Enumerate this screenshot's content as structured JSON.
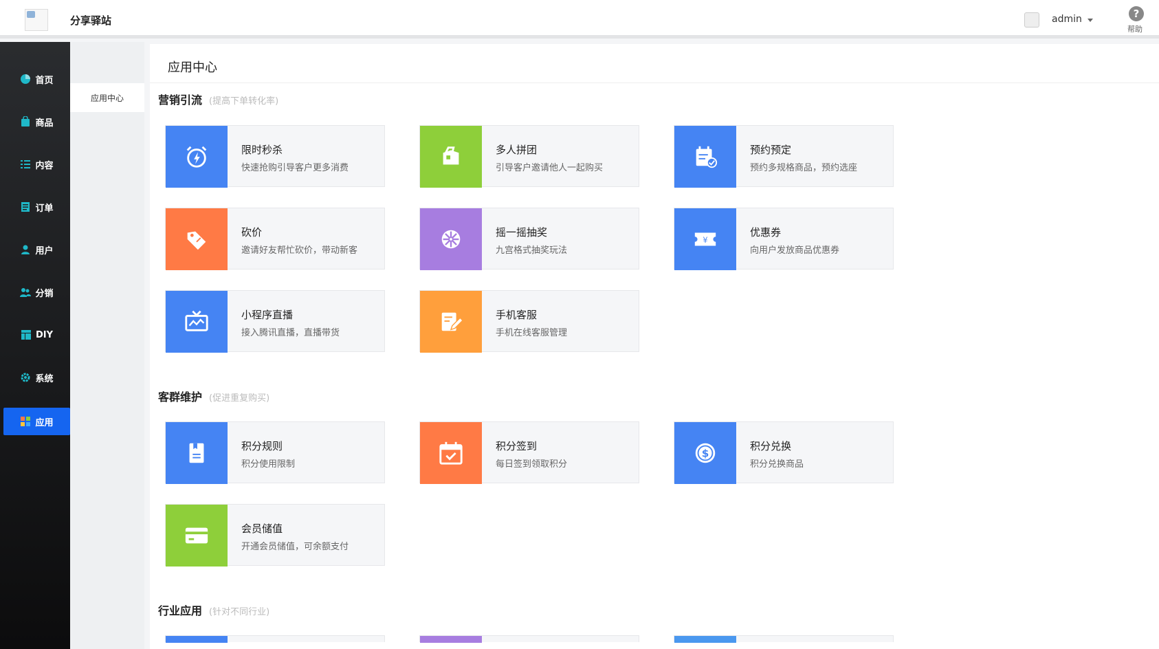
{
  "header": {
    "site_title": "分享驿站",
    "user_name": "admin",
    "help_label": "帮助"
  },
  "sidebar": {
    "items": [
      {
        "label": "首页",
        "icon": "pie-chart-icon"
      },
      {
        "label": "商品",
        "icon": "bag-icon"
      },
      {
        "label": "内容",
        "icon": "list-icon"
      },
      {
        "label": "订单",
        "icon": "order-icon"
      },
      {
        "label": "用户",
        "icon": "user-icon"
      },
      {
        "label": "分销",
        "icon": "users-icon"
      },
      {
        "label": "DIY",
        "icon": "layout-icon"
      },
      {
        "label": "系统",
        "icon": "gear-icon"
      },
      {
        "label": "应用",
        "icon": "apps-icon"
      }
    ],
    "active": "应用"
  },
  "sub_sidebar": {
    "item": "应用中心"
  },
  "main": {
    "page_title": "应用中心",
    "sections": [
      {
        "title": "营销引流",
        "subtitle": "(提高下单转化率)",
        "cards": [
          {
            "title": "限时秒杀",
            "desc": "快速抢购引导客户更多消费",
            "color": "#4584f3",
            "icon": "alarm-icon"
          },
          {
            "title": "多人拼团",
            "desc": "引导客户邀请他人一起购买",
            "color": "#8ecf3a",
            "icon": "tag-icon"
          },
          {
            "title": "预约预定",
            "desc": "预约多规格商品，预约选座",
            "color": "#4584f3",
            "icon": "calendar-check-icon"
          },
          {
            "title": "砍价",
            "desc": "邀请好友帮忙砍价，带动新客",
            "color": "#ff7a45",
            "icon": "price-tag-icon"
          },
          {
            "title": "摇一摇抽奖",
            "desc": "九宫格式抽奖玩法",
            "color": "#a77de0",
            "icon": "wheel-icon"
          },
          {
            "title": "优惠券",
            "desc": "向用户发放商品优惠券",
            "color": "#4584f3",
            "icon": "coupon-icon"
          },
          {
            "title": "小程序直播",
            "desc": "接入腾讯直播，直播带货",
            "color": "#4584f3",
            "icon": "tv-icon"
          },
          {
            "title": "手机客服",
            "desc": "手机在线客服管理",
            "color": "#ff9f3c",
            "icon": "edit-icon"
          }
        ]
      },
      {
        "title": "客群维护",
        "subtitle": "(促进重复购买)",
        "cards": [
          {
            "title": "积分规则",
            "desc": "积分使用限制",
            "color": "#4584f3",
            "icon": "rules-icon"
          },
          {
            "title": "积分签到",
            "desc": "每日签到领取积分",
            "color": "#ff7a45",
            "icon": "checkin-icon"
          },
          {
            "title": "积分兑换",
            "desc": "积分兑换商品",
            "color": "#4584f3",
            "icon": "coin-icon"
          },
          {
            "title": "会员储值",
            "desc": "开通会员储值，可余额支付",
            "color": "#8ecf3a",
            "icon": "card-icon"
          }
        ]
      },
      {
        "title": "行业应用",
        "subtitle": "(针对不同行业)",
        "partial_colors": [
          "#4584f3",
          "#a77de0",
          "#4a98ef"
        ]
      }
    ]
  }
}
